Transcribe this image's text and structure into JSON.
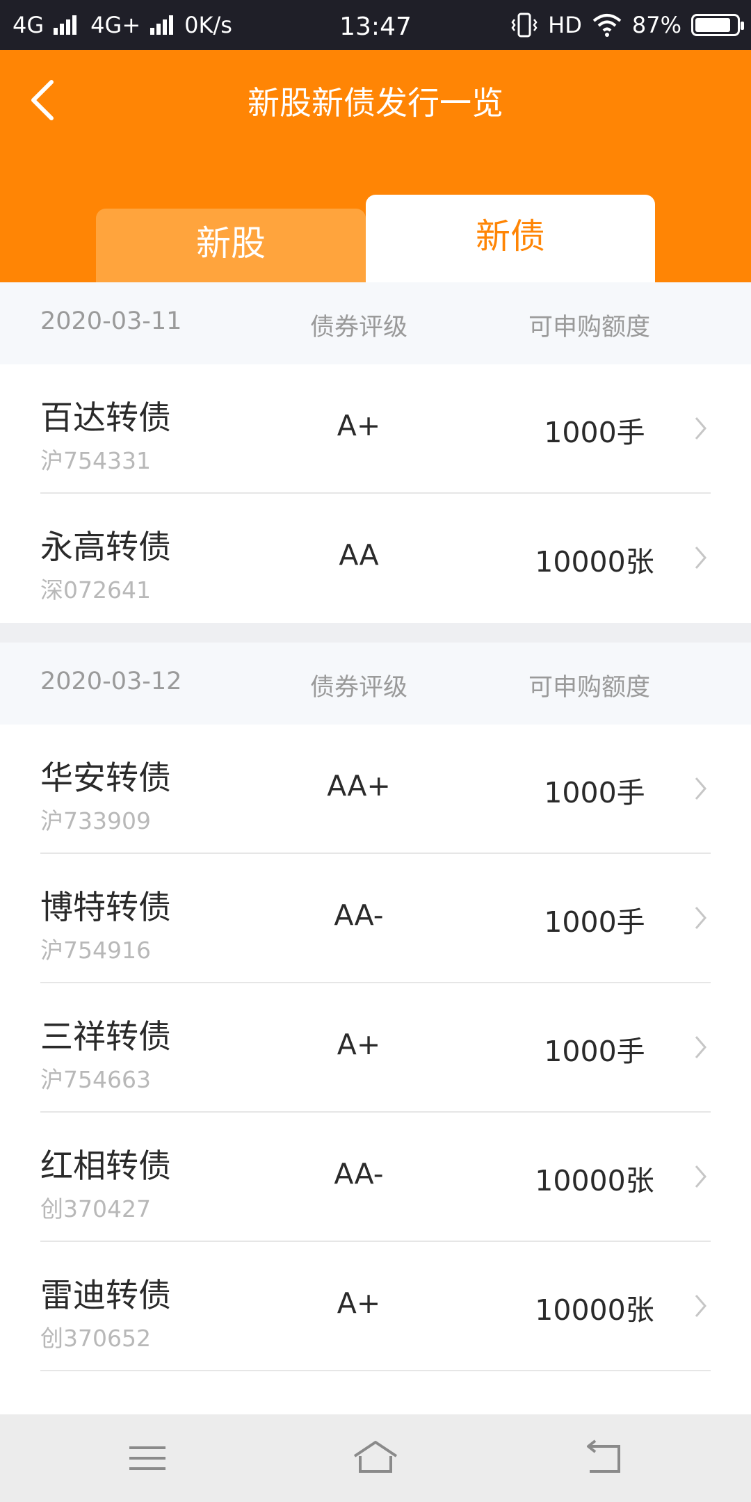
{
  "status_bar": {
    "network_1": "4G",
    "network_2": "4G+",
    "speed": "0K/s",
    "time": "13:47",
    "hd": "HD",
    "battery_percent": "87%",
    "battery_level": 0.87
  },
  "header": {
    "title": "新股新债发行一览",
    "tabs": [
      {
        "label": "新股",
        "active": false
      },
      {
        "label": "新债",
        "active": true
      }
    ]
  },
  "groups": [
    {
      "date": "2020-03-11",
      "col_rating": "债券评级",
      "col_quota": "可申购额度",
      "rows": [
        {
          "name": "百达转债",
          "code": "沪754331",
          "rating": "A+",
          "quota": "1000手"
        },
        {
          "name": "永高转债",
          "code": "深072641",
          "rating": "AA",
          "quota": "10000张"
        }
      ]
    },
    {
      "date": "2020-03-12",
      "col_rating": "债券评级",
      "col_quota": "可申购额度",
      "rows": [
        {
          "name": "华安转债",
          "code": "沪733909",
          "rating": "AA+",
          "quota": "1000手"
        },
        {
          "name": "博特转债",
          "code": "沪754916",
          "rating": "AA-",
          "quota": "1000手"
        },
        {
          "name": "三祥转债",
          "code": "沪754663",
          "rating": "A+",
          "quota": "1000手"
        },
        {
          "name": "红相转债",
          "code": "创370427",
          "rating": "AA-",
          "quota": "10000张"
        },
        {
          "name": "雷迪转债",
          "code": "创370652",
          "rating": "A+",
          "quota": "10000张"
        }
      ]
    }
  ],
  "colors": {
    "accent": "#ff8505",
    "tab_inactive": "#ffa43d",
    "status_bar": "#1f1f28"
  },
  "icons": {
    "back": "back-arrow-icon",
    "row_chevron": "chevron-right-icon",
    "nav_menu": "menu-icon",
    "nav_home": "home-icon",
    "nav_back": "return-icon"
  }
}
